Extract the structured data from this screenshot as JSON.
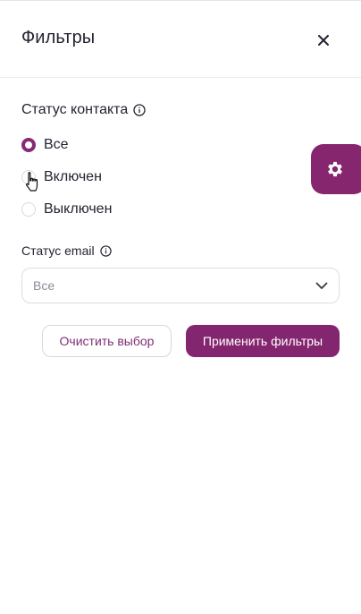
{
  "header": {
    "title": "Фильтры",
    "close_icon": "close-icon"
  },
  "contact_status": {
    "label": "Статус контакта",
    "options": [
      {
        "label": "Все",
        "checked": true
      },
      {
        "label": "Включен",
        "checked": false
      },
      {
        "label": "Выключен",
        "checked": false
      }
    ]
  },
  "email_status": {
    "label": "Статус email",
    "selected": "Все"
  },
  "actions": {
    "clear_label": "Очистить выбор",
    "apply_label": "Применить фильтры"
  },
  "floating_button": {
    "icon": "gear-icon"
  },
  "colors": {
    "accent": "#84266f",
    "text": "#262330",
    "border": "#dedde3",
    "muted": "#8d8b96"
  }
}
